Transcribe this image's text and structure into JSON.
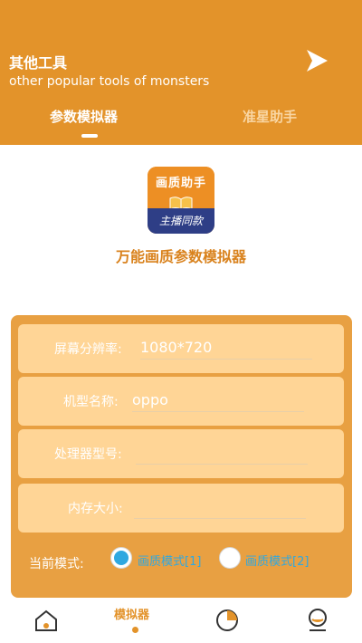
{
  "header": {
    "title": "其他工具",
    "subtitle": "other popular tools of monsters",
    "background": "#E3932A"
  },
  "tabs": [
    {
      "label": "参数模拟器",
      "active": true
    },
    {
      "label": "准星助手",
      "active": false
    }
  ],
  "app": {
    "icon_top_text": "画质助手",
    "icon_bottom_text": "主播同款",
    "name": "万能画质参数模拟器"
  },
  "form": {
    "resolution": {
      "label": "屏幕分辨率:",
      "value": "1080*720"
    },
    "model": {
      "label": "机型名称:",
      "value": "oppo"
    },
    "processor": {
      "label": "处理器型号:",
      "value": ""
    },
    "memory": {
      "label": "内存大小:",
      "value": ""
    },
    "mode": {
      "label": "当前模式:",
      "options": [
        "画质模式[1]",
        "画质模式[2]"
      ],
      "selected": "画质模式[1]"
    }
  },
  "bottom_nav": {
    "items": [
      "home-icon",
      "simulator",
      "pie-chart-icon",
      "profile-icon"
    ],
    "active_label": "模拟器"
  },
  "colors": {
    "accent": "#E3932A",
    "card": "#E8A042",
    "row": "#FFD596",
    "radio": "#2FA8E0"
  }
}
